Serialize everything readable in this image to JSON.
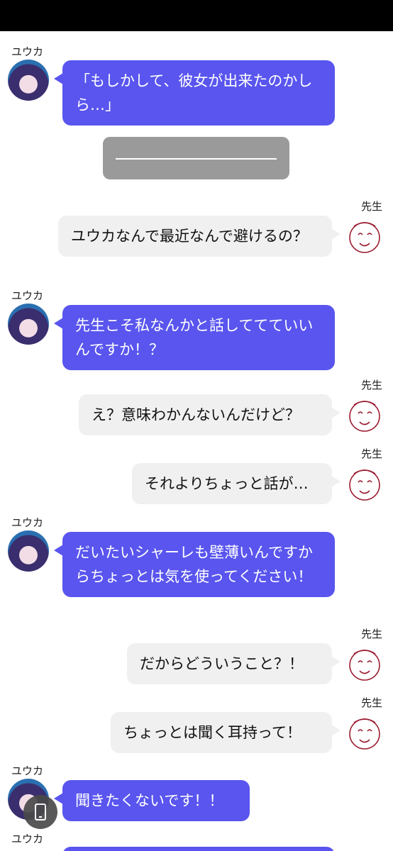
{
  "names": {
    "yuuka": "ユウカ",
    "sensei": "先生"
  },
  "messages": [
    "「もしかして、彼女が出来たのかしら…」",
    "ユウカなんで最近なんで避けるの？",
    "先生こそ私なんかと話しててていいんですか！？",
    "え？意味わかんないんだけど？",
    "それよりちょっと話が…",
    "だいたいシャーレも壁薄いんですからちょっとは気を使ってください！",
    "だからどういうこと？！",
    "ちょっとは聞く耳持って！",
    "聞きたくないです！！"
  ],
  "icons": {
    "avatar_yuuka": "yuuka-avatar-icon",
    "avatar_sensei": "sensei-smiley-icon",
    "floating": "phone-icon"
  },
  "colors": {
    "yuuka_bubble": "#5955ee",
    "sensei_bubble": "#f0f0f0",
    "divider": "#9a9a9a"
  }
}
